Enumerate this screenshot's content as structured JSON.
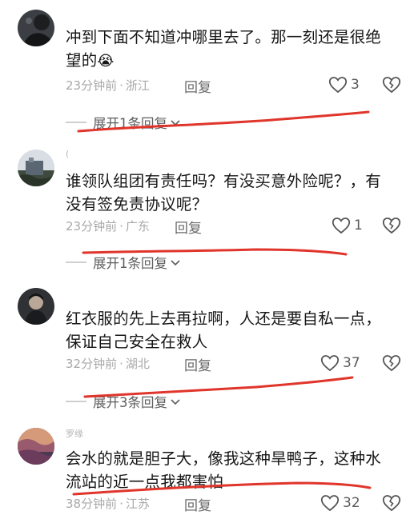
{
  "comments": [
    {
      "username": "",
      "text_line1": "冲到下面不知道冲哪里去了。那一刻还是很绝",
      "text_line2": "望的",
      "emoji": "😭",
      "time": "23分钟前",
      "location": "浙江",
      "reply_label": "回复",
      "likes": "3",
      "expand_label": "展开1条回复"
    },
    {
      "username": "(",
      "text_line1": "谁领队组团有责任吗？有没买意外险呢？，有",
      "text_line2": "没有签免责协议呢？",
      "time": "23分钟前",
      "location": "广东",
      "reply_label": "回复",
      "likes": "1",
      "expand_label": "展开1条回复"
    },
    {
      "username": "",
      "text_line1": "红衣服的先上去再拉啊，人还是要自私一点，",
      "text_line2": "保证自己安全在救人",
      "time": "32分钟前",
      "location": "湖北",
      "reply_label": "回复",
      "likes": "37",
      "expand_label": "展开3条回复"
    },
    {
      "username": "罗缘",
      "text_line1": "会水的就是胆子大，像我这种旱鸭子，这种水",
      "text_line2": "流站的近一点我都害怕",
      "time": "38分钟前",
      "location": "江苏",
      "reply_label": "回复",
      "likes": "32"
    }
  ],
  "colors": {
    "text": "#161616",
    "meta": "#a8a8a8",
    "annotation_red": "#e0352b"
  },
  "icons": {
    "like": "heart-outline-icon",
    "dislike": "broken-heart-icon",
    "expand": "chevron-down-icon"
  }
}
